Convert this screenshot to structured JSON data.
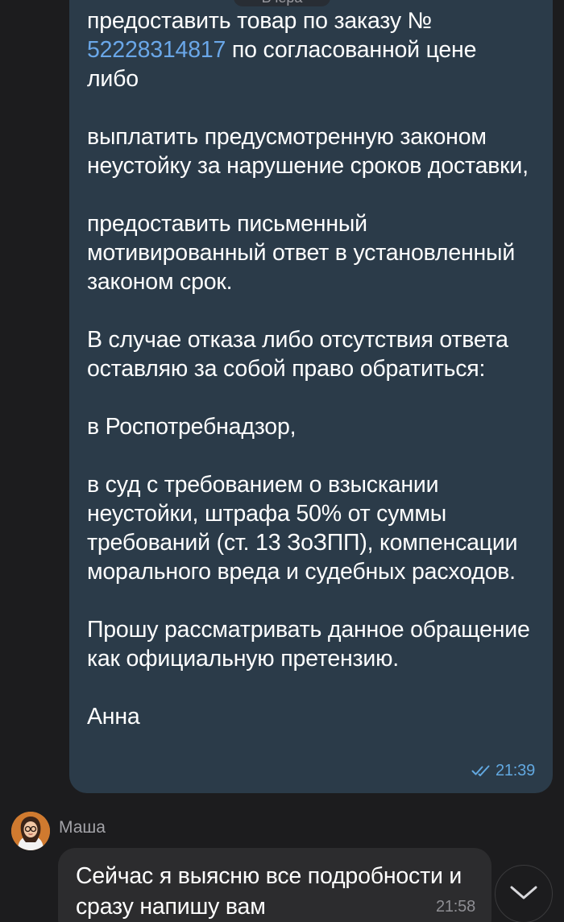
{
  "date_label": "Вчера",
  "outgoing_message": {
    "order_prefix": "предоставить товар по заказу №",
    "order_number": "52228314817",
    "order_suffix": " по согласованной цене либо",
    "p_penalty": "выплатить предусмотренную законом неустойку за нарушение сроков доставки,",
    "p_response": "предоставить письменный мотивированный ответ в установленный законом срок.",
    "p_refusal": "В случае отказа либо отсутствия ответа оставляю за собой право обратиться:",
    "p_authority": "в Роспотребнадзор,",
    "p_court": "в суд с требованием о взыскании неустойки, штрафа 50% от суммы требований (ст. 13 ЗоЗПП), компенсации морального вреда и судебных расходов.",
    "p_claim": "Прошу рассматривать данное обращение как официальную претензию.",
    "signature": "Анна",
    "time": "21:39",
    "status_icon": "double-check-read",
    "bubble_color": "#2b3b49",
    "link_color": "#6aa7e8"
  },
  "incoming_message": {
    "sender": "Маша",
    "avatar_icon": "user-avatar",
    "text": "Сейчас я выясню все подробности и сразу напишу вам",
    "time": "21:58",
    "bubble_color": "#2c2c2e"
  },
  "scroll_button_icon": "chevron-down-icon",
  "colors": {
    "background": "#1c1c1e",
    "accent": "#62a8e0"
  }
}
